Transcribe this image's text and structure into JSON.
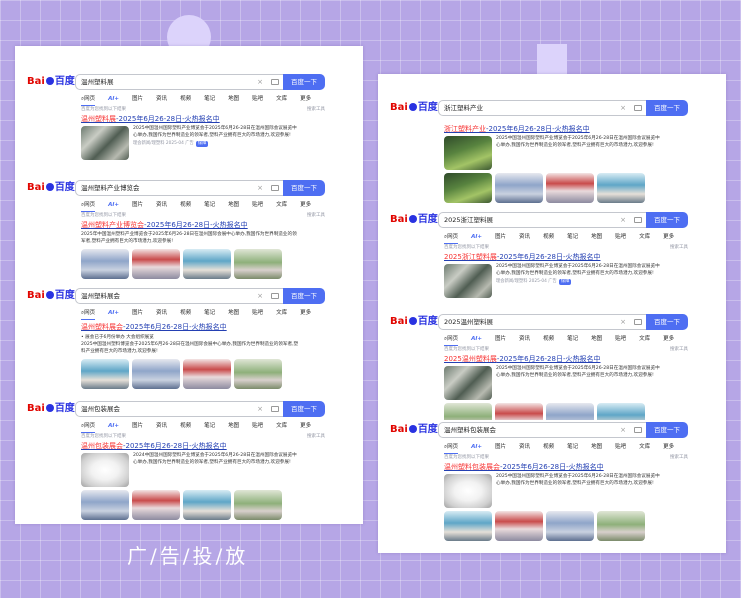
{
  "caption": "广/告/投/放",
  "logo": {
    "text_bai": "Bai",
    "text_du": "百度"
  },
  "search_button": "百度一下",
  "clear_symbol": "×",
  "tabs": {
    "web": "网页",
    "ai": "AI+",
    "images": "图片",
    "news": "资讯",
    "video": "视频",
    "notes": "笔记",
    "maps": "地图",
    "tieba": "贴吧",
    "wenku": "文库",
    "more": "更多"
  },
  "hint": "百度为您找到以下结果",
  "tools": "搜索工具",
  "left_card": {
    "s1": {
      "query": "温州塑料展",
      "title_red": "温州塑料展",
      "title_rest": "-2025年6月26-28日-火热报名中",
      "desc": "2025中国温州国际塑料产业博览会于2025年6月26-28日在温州国际会议展览中心举办,我国作为世界制造业的领军者,塑料产业拥有巨大的市场潜力,欢迎参展!",
      "meta_site": "理会新闻/理塑料 2025-04",
      "meta_ad": "广告",
      "meta_v": "保障"
    },
    "s2": {
      "query": "温州塑料产业博览会",
      "title_red": "温州塑料产业博览会",
      "title_rest": "-2025年6月26-28日-火热报名中",
      "desc": "2025年中国温州塑料产业博览会于2025年6月26-28日在温州国际会展中心举办,我国作为世界制造业的领军者,塑料产业拥有巨大的市场潜力,欢迎参展!"
    },
    "s3": {
      "query": "温州塑料展会",
      "title_red": "温州塑料展会",
      "title_rest": "-2025年6月26-28日-火热报名中",
      "short": "• 展会已于6月份举办 大会组织展览",
      "desc": "2025中国温州塑料博览会于2025年6月26-28日在温州国际会展中心举办,我国作为世界制造业的领军者,塑料产业拥有巨大的市场潜力,欢迎参展!"
    },
    "s4": {
      "query": "温州包装展会",
      "title_red": "温州包装展会",
      "title_rest": "-2025年6月26-28日-火热报名中",
      "desc": "2024中国温州国际塑料产业博览会于2025年6月26-28日在温州国际会议展览中心举办,我国作为世界制造业的领军者,塑料产业拥有巨大的市场潜力,欢迎参展!"
    }
  },
  "right_card": {
    "s1": {
      "query": "浙江塑料产业",
      "title_red": "浙江塑料产业",
      "title_rest": "-2025年6月26-28日-火热报名中",
      "desc": "2025中国温州国际塑料产业博览会于2025年6月26-28日在温州国际会议展览中心举办,我国作为世界制造业的领军者,塑料产业拥有巨大的市场潜力,欢迎参展!"
    },
    "s2": {
      "query": "2025浙江塑料展",
      "title_red": "2025浙江塑料展",
      "title_rest": "-2025年6月26-28日-火热报名中",
      "desc": "2025中国温州国际塑料产业博览会于2025年6月26-28日在温州国际会议展览中心举办,我国作为世界制造业的领军者,塑料产业拥有巨大的市场潜力,欢迎参展!",
      "meta_site": "理会新闻/理塑料 2025-04",
      "meta_ad": "广告",
      "meta_v": "保障"
    },
    "s3": {
      "query": "2025温州塑料展",
      "title_red": "2025温州塑料展",
      "title_rest": "-2025年6月26-28日-火热报名中",
      "desc": "2025中国温州国际塑料产业博览会于2025年6月26-28日在温州国际会议展览中心举办,我国作为世界制造业的领军者,塑料产业拥有巨大的市场潜力,欢迎参展!"
    },
    "s4": {
      "query": "温州塑料包装展会",
      "title_red": "温州塑料包装展会",
      "title_rest": "-2025年6月26-28日-火热报名中",
      "desc": "2025中国温州国际塑料产业博览会于2025年6月26-28日在温州国际会议展览中心举办,我国作为世界制造业的领军者,塑料产业拥有巨大的市场潜力,欢迎参展!"
    }
  }
}
